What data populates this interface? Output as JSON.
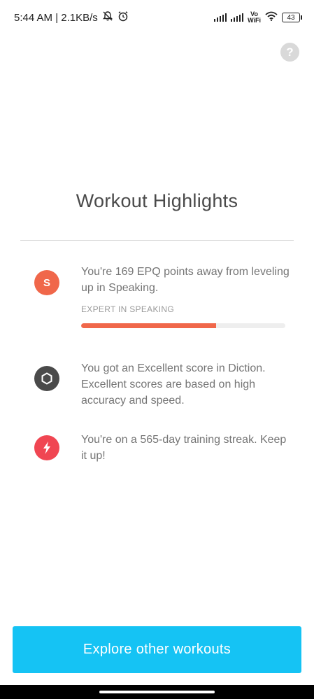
{
  "status_bar": {
    "time_speed": "5:44 AM | 2.1KB/s",
    "volte_top": "Vo",
    "volte_bottom": "WiFi",
    "battery": "43"
  },
  "page": {
    "title": "Workout Highlights"
  },
  "highlights": [
    {
      "icon_letter": "S",
      "icon_name": "speaking-icon",
      "icon_color": "#f0674a",
      "text": "You're 169 EPQ points away from leveling up in Speaking.",
      "progress_label": "EXPERT IN SPEAKING",
      "progress_percent": 66
    },
    {
      "icon_name": "hexagon-icon",
      "icon_color": "#4a4a4a",
      "text": "You got an Excellent score in Diction. Excellent scores are based on high accuracy and speed."
    },
    {
      "icon_name": "lightning-icon",
      "icon_color": "#f04652",
      "text": "You're on a 565-day training streak. Keep it up!"
    }
  ],
  "cta": {
    "label": "Explore other workouts",
    "color": "#15c3f4"
  },
  "help": {
    "glyph": "?"
  }
}
